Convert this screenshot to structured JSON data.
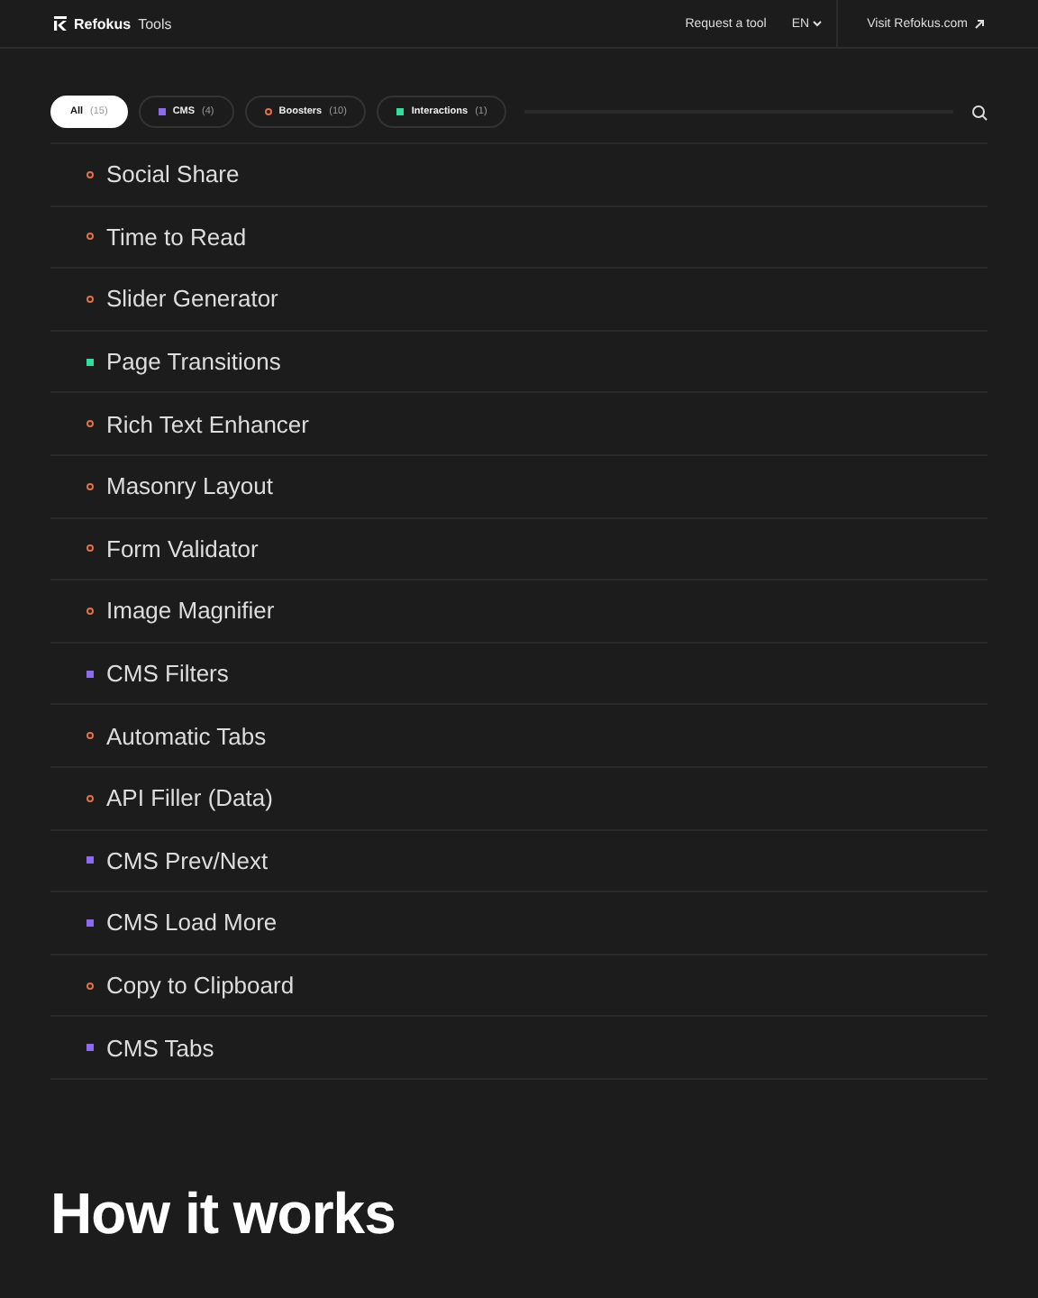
{
  "header": {
    "brand": "Refokus",
    "product": "Tools",
    "links": [
      {
        "label": "Request a tool"
      }
    ],
    "language": "EN",
    "external_link": "Visit Refokus.com"
  },
  "filters": [
    {
      "label": "All",
      "count": "(15)",
      "selected": true,
      "kind": "all"
    },
    {
      "label": "CMS",
      "count": "(4)",
      "selected": false,
      "kind": "cms"
    },
    {
      "label": "Boosters",
      "count": "(10)",
      "selected": false,
      "kind": "booster"
    },
    {
      "label": "Interactions",
      "count": "(1)",
      "selected": false,
      "kind": "interaction"
    }
  ],
  "tools": [
    {
      "name": "Social Share",
      "kind": "booster"
    },
    {
      "name": "Time to Read",
      "kind": "booster"
    },
    {
      "name": "Slider Generator",
      "kind": "booster"
    },
    {
      "name": "Page Transitions",
      "kind": "interaction"
    },
    {
      "name": "Rich Text Enhancer",
      "kind": "booster"
    },
    {
      "name": "Masonry Layout",
      "kind": "booster"
    },
    {
      "name": "Form Validator",
      "kind": "booster"
    },
    {
      "name": "Image Magnifier",
      "kind": "booster"
    },
    {
      "name": "CMS Filters",
      "kind": "cms"
    },
    {
      "name": "Automatic Tabs",
      "kind": "booster"
    },
    {
      "name": "API Filler (Data)",
      "kind": "booster"
    },
    {
      "name": "CMS Prev/Next",
      "kind": "cms"
    },
    {
      "name": "CMS Load More",
      "kind": "cms"
    },
    {
      "name": "Copy to Clipboard",
      "kind": "booster"
    },
    {
      "name": "CMS Tabs",
      "kind": "cms"
    }
  ],
  "section": {
    "heading": "How it works"
  }
}
